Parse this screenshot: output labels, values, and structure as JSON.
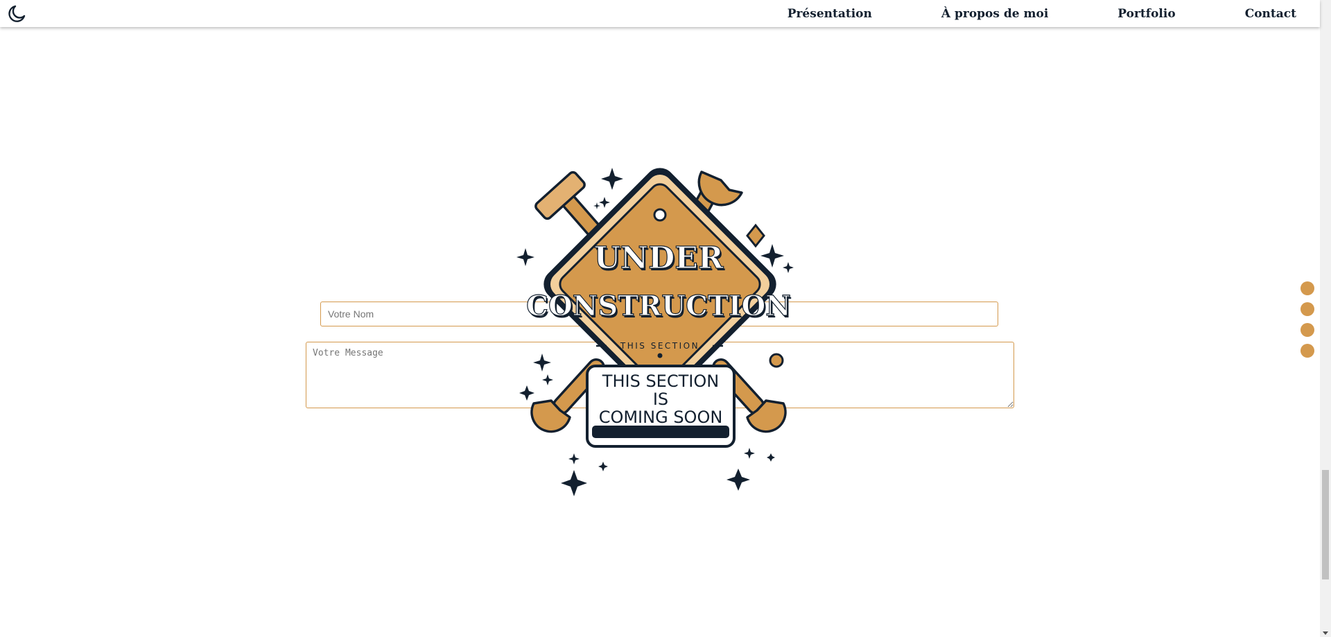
{
  "header": {
    "theme_icon": "moon-icon",
    "nav": [
      {
        "label": "Présentation"
      },
      {
        "label": "À propos de moi"
      },
      {
        "label": "Portfolio"
      },
      {
        "label": "Contact"
      }
    ]
  },
  "form": {
    "name_placeholder": "Votre Nom",
    "name_value": "",
    "message_placeholder": "Votre Message",
    "message_value": ""
  },
  "overlay": {
    "sign_line1": "UNDER",
    "sign_line2": "CONSTRUCTION",
    "sign_small": "THIS SECTION",
    "plaque_line1": "THIS SECTION",
    "plaque_line2": "IS",
    "plaque_line3": "COMING SOON"
  },
  "side_nav": {
    "dot_count": 4
  },
  "colors": {
    "accent": "#d4994d",
    "dark": "#13202f",
    "background": "#ffffff"
  }
}
